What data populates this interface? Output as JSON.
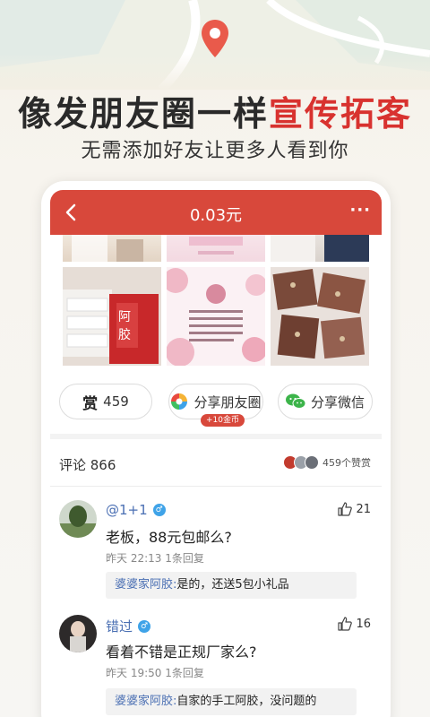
{
  "promo": {
    "headline_main": "像发朋友圈一样",
    "headline_highlight": "宣传拓客",
    "subline": "无需添加好友让更多人看到你"
  },
  "colors": {
    "accent": "#d8483b",
    "headline_highlight": "#d8322f",
    "link": "#4a6fb3",
    "background": "#f7f4ee"
  },
  "app": {
    "header": {
      "title": "0.03元",
      "back_icon": "chevron-left-icon",
      "more_label": "···"
    },
    "actions": {
      "reward_icon": "赏",
      "reward_count": "459",
      "share_moments_label": "分享朋友圈",
      "share_moments_bonus": "+10金币",
      "share_wechat_label": "分享微信"
    },
    "comments_header": {
      "label": "评论 866",
      "likes_label": "459个赞赏"
    },
    "comments": [
      {
        "user": "@1+1",
        "text": "老板，88元包邮么?",
        "meta": "昨天 22:13 1条回复",
        "likes": "21",
        "reply_name": "婆婆家阿胶:",
        "reply_text": "是的，还送5包小礼品"
      },
      {
        "user": "错过",
        "text": "看着不错是正规厂家么?",
        "meta": "昨天 19:50 1条回复",
        "likes": "16",
        "reply_name": "婆婆家阿胶:",
        "reply_text": "自家的手工阿胶，没问题的"
      }
    ]
  }
}
